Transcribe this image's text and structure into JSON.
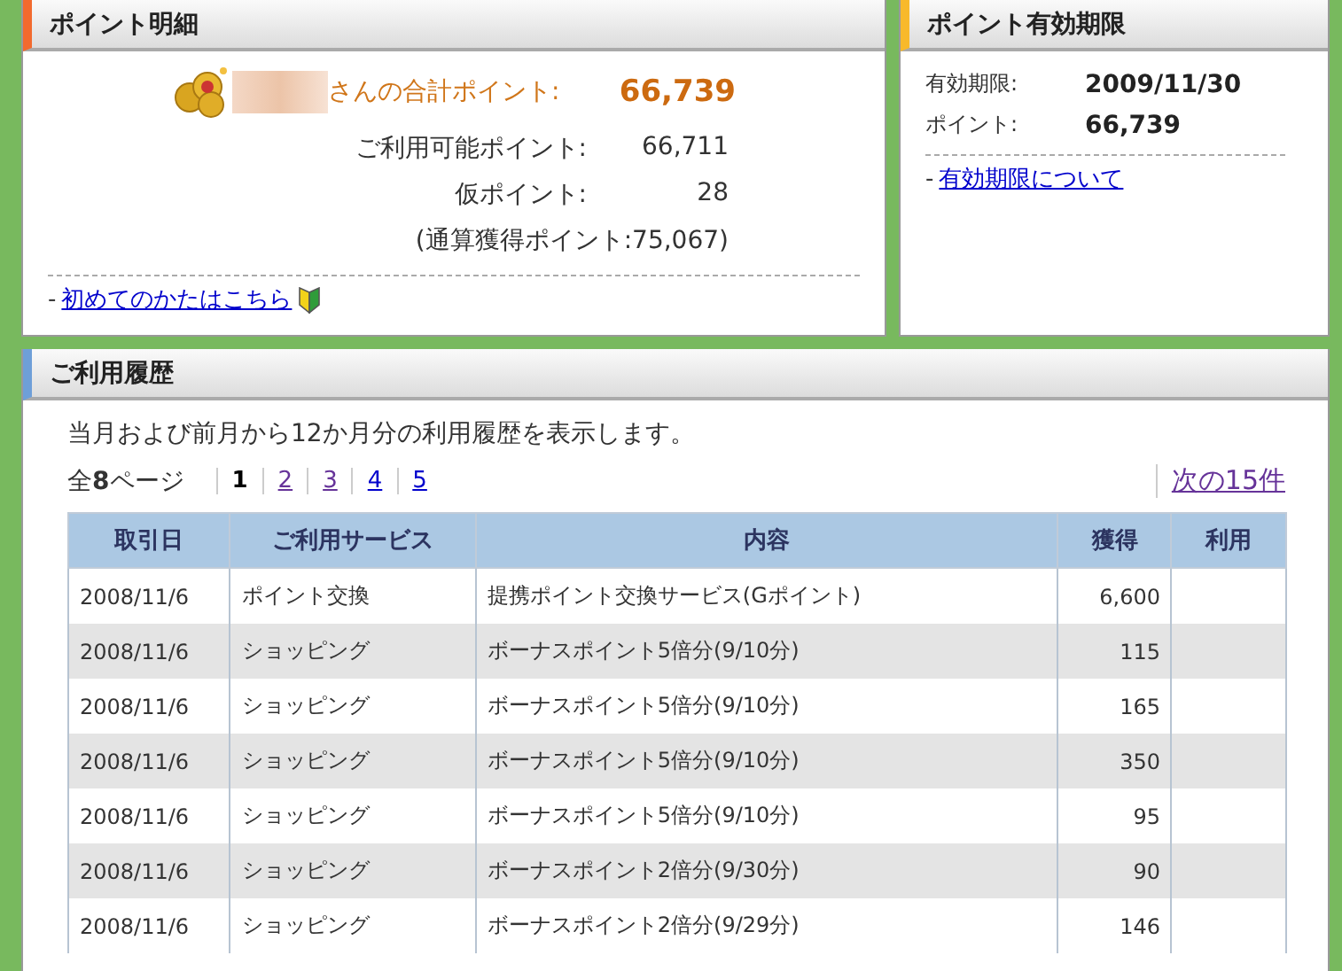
{
  "point_detail": {
    "title": "ポイント明細",
    "total_label": "さんの合計ポイント:",
    "total_value": "66,739",
    "rows": [
      {
        "label": "ご利用可能ポイント:",
        "value": "66,711"
      },
      {
        "label": "仮ポイント:",
        "value": "28"
      }
    ],
    "cumulative": "(通算獲得ポイント:75,067)",
    "bullet": "-",
    "link": "初めてのかたはこちら"
  },
  "expiry": {
    "title": "ポイント有効期限",
    "rows": [
      {
        "label": "有効期限:",
        "value": "2009/11/30"
      },
      {
        "label": "ポイント:",
        "value": "66,739"
      }
    ],
    "bullet": "-",
    "link": "有効期限について"
  },
  "history": {
    "title": "ご利用履歴",
    "description": "当月および前月から12か月分の利用履歴を表示します。",
    "page_count": "全**8**ページ",
    "pages": [
      {
        "label": "1",
        "selected": true,
        "visited": false
      },
      {
        "label": "2",
        "selected": false,
        "visited": true
      },
      {
        "label": "3",
        "selected": false,
        "visited": true
      },
      {
        "label": "4",
        "selected": false,
        "visited": false
      },
      {
        "label": "5",
        "selected": false,
        "visited": false
      }
    ],
    "next": "次の15件",
    "table": {
      "columns": [
        "取引日",
        "ご利用サービス",
        "内容",
        "獲得",
        "利用"
      ],
      "rows": [
        [
          "2008/11/6",
          "ポイント交換",
          "提携ポイント交換サービス(Gポイント)",
          "6,600"
        ],
        [
          "2008/11/6",
          "ショッピング",
          "ボーナスポイント5倍分(9/10分)",
          "115"
        ],
        [
          "2008/11/6",
          "ショッピング",
          "ボーナスポイント5倍分(9/10分)",
          "165"
        ],
        [
          "2008/11/6",
          "ショッピング",
          "ボーナスポイント5倍分(9/10分)",
          "350"
        ],
        [
          "2008/11/6",
          "ショッピング",
          "ボーナスポイント5倍分(9/10分)",
          "95"
        ],
        [
          "2008/11/6",
          "ショッピング",
          "ボーナスポイント2倍分(9/30分)",
          "90"
        ],
        [
          "2008/11/6",
          "ショッピング",
          "ボーナスポイント2倍分(9/29分)",
          "146"
        ]
      ]
    }
  }
}
